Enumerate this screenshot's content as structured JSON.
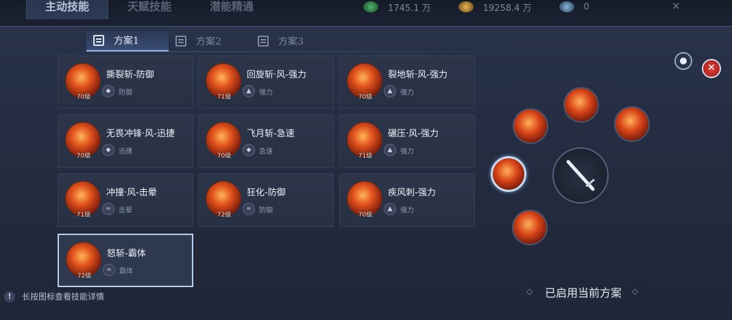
{
  "top_tabs": [
    "主动技能",
    "天赋技能",
    "潜能精通"
  ],
  "currencies": [
    {
      "icon": "green-gem-icon",
      "value": "1745.1 万"
    },
    {
      "icon": "gold-coin-icon",
      "value": "19258.4 万"
    },
    {
      "icon": "blue-shard-icon",
      "value": "0"
    }
  ],
  "top_close": "✕",
  "plan_tabs": [
    "方案1",
    "方案2",
    "方案3"
  ],
  "skills": [
    {
      "name": "撕裂斩-防御",
      "level": "70级",
      "tag": "防御",
      "tag_icon": "shield-icon"
    },
    {
      "name": "回旋斩·风-强力",
      "level": "71级",
      "tag": "强力",
      "tag_icon": "power-icon"
    },
    {
      "name": "裂地斩·风-强力",
      "level": "70级",
      "tag": "强力",
      "tag_icon": "power-icon"
    },
    {
      "name": "无畏冲锋·风-迅捷",
      "level": "70级",
      "tag": "迅捷",
      "tag_icon": "shield-icon"
    },
    {
      "name": "飞月斩-急速",
      "level": "70级",
      "tag": "急速",
      "tag_icon": "shield-icon"
    },
    {
      "name": "碾压·风-强力",
      "level": "71级",
      "tag": "强力",
      "tag_icon": "power-icon"
    },
    {
      "name": "冲撞·风-击晕",
      "level": "71级",
      "tag": "击晕",
      "tag_icon": "stun-icon"
    },
    {
      "name": "狂化-防御",
      "level": "72级",
      "tag": "防御",
      "tag_icon": "stun-icon"
    },
    {
      "name": "疾风刺-强力",
      "level": "70级",
      "tag": "强力",
      "tag_icon": "power-icon"
    },
    {
      "name": "怒斩-霸体",
      "level": "72级",
      "tag": "霸体",
      "tag_icon": "stun-icon"
    }
  ],
  "enabled_text": "已启用当前方案",
  "hint_icon": "!",
  "hint_text": "长按图标查看技能详情",
  "close_symbol": "✕"
}
